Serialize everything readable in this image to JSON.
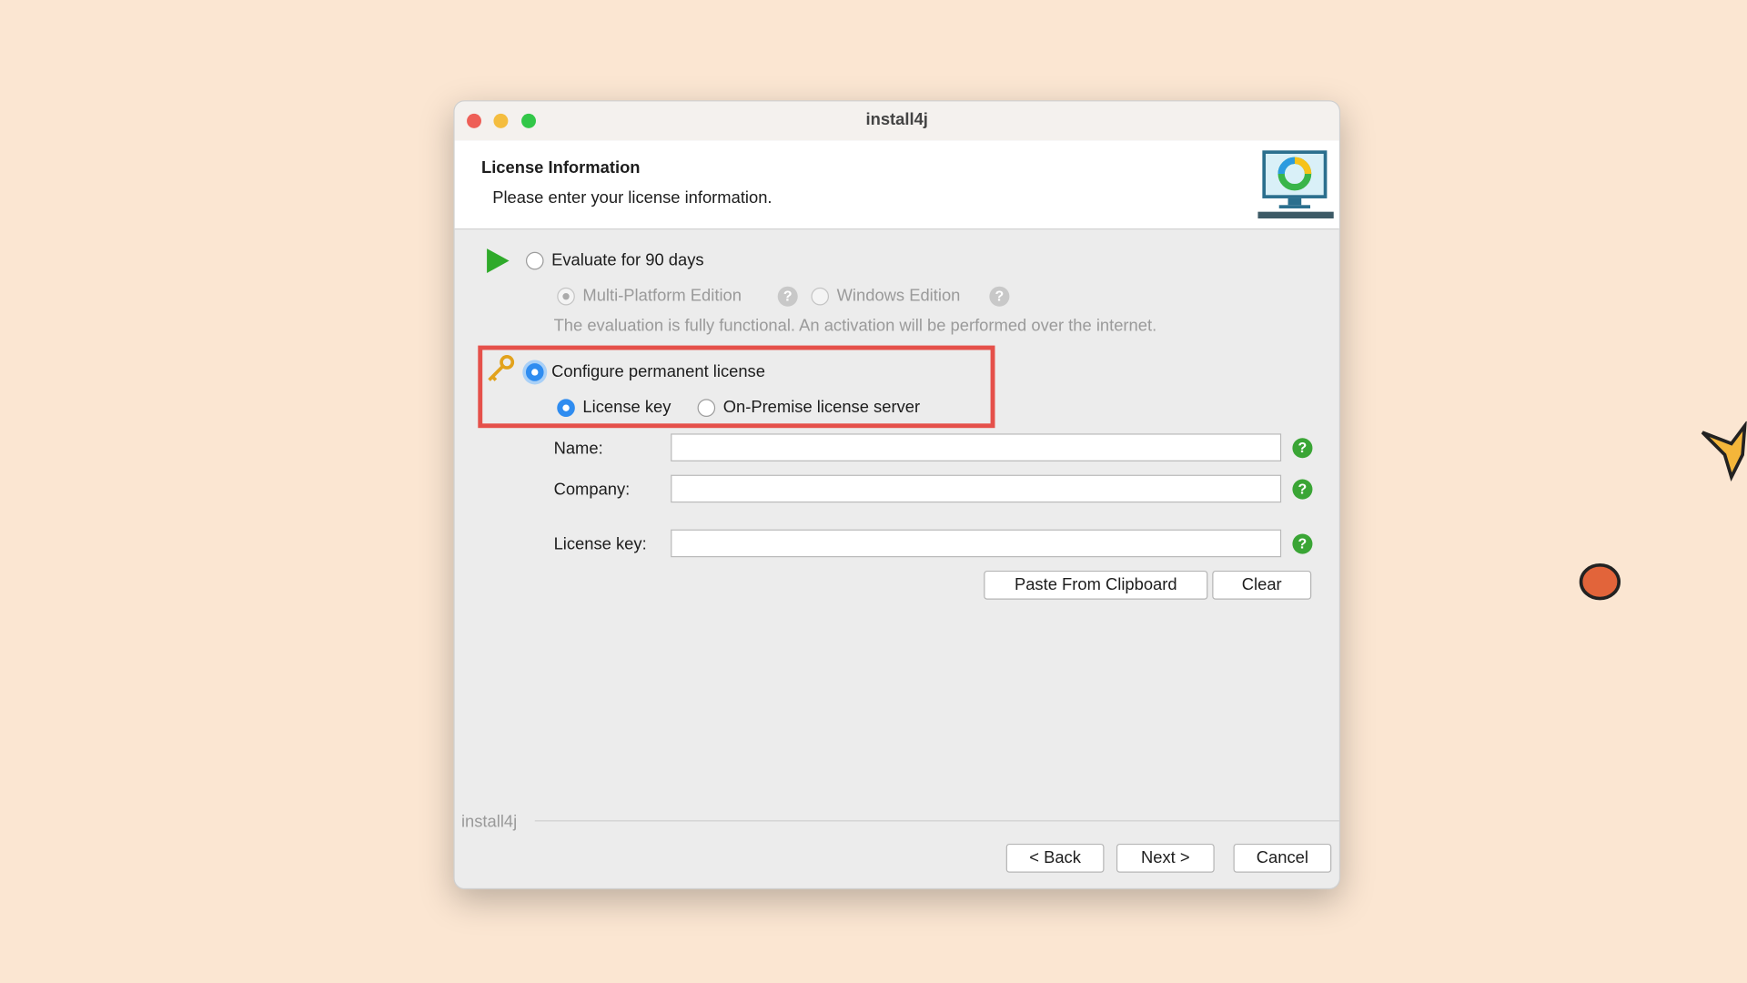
{
  "window": {
    "title": "install4j"
  },
  "header": {
    "title": "License Information",
    "subtitle": "Please enter your license information.",
    "icon": "monitor-logo-icon"
  },
  "evaluate": {
    "label": "Evaluate for 90 days",
    "selected": false,
    "editions": [
      {
        "label": "Multi-Platform Edition",
        "selected": true,
        "enabled": false
      },
      {
        "label": "Windows Edition",
        "selected": false,
        "enabled": false
      }
    ],
    "description": "The evaluation is fully functional. An activation will be performed over the internet."
  },
  "permanent": {
    "label": "Configure permanent license",
    "selected": true,
    "options": [
      {
        "label": "License key",
        "selected": true
      },
      {
        "label": "On-Premise license server",
        "selected": false
      }
    ]
  },
  "form": {
    "name_label": "Name:",
    "name_value": "",
    "company_label": "Company:",
    "company_value": "",
    "key_label": "License key:",
    "key_value": "",
    "help": "?"
  },
  "actions": {
    "paste": "Paste From Clipboard",
    "clear": "Clear"
  },
  "footer": {
    "brand": "install4j",
    "back": "< Back",
    "next": "Next >",
    "cancel": "Cancel"
  },
  "colors": {
    "background": "#fbe6d2",
    "accent": "#2f8cf0",
    "highlight": "#e5504a",
    "help": "#3aa535"
  }
}
